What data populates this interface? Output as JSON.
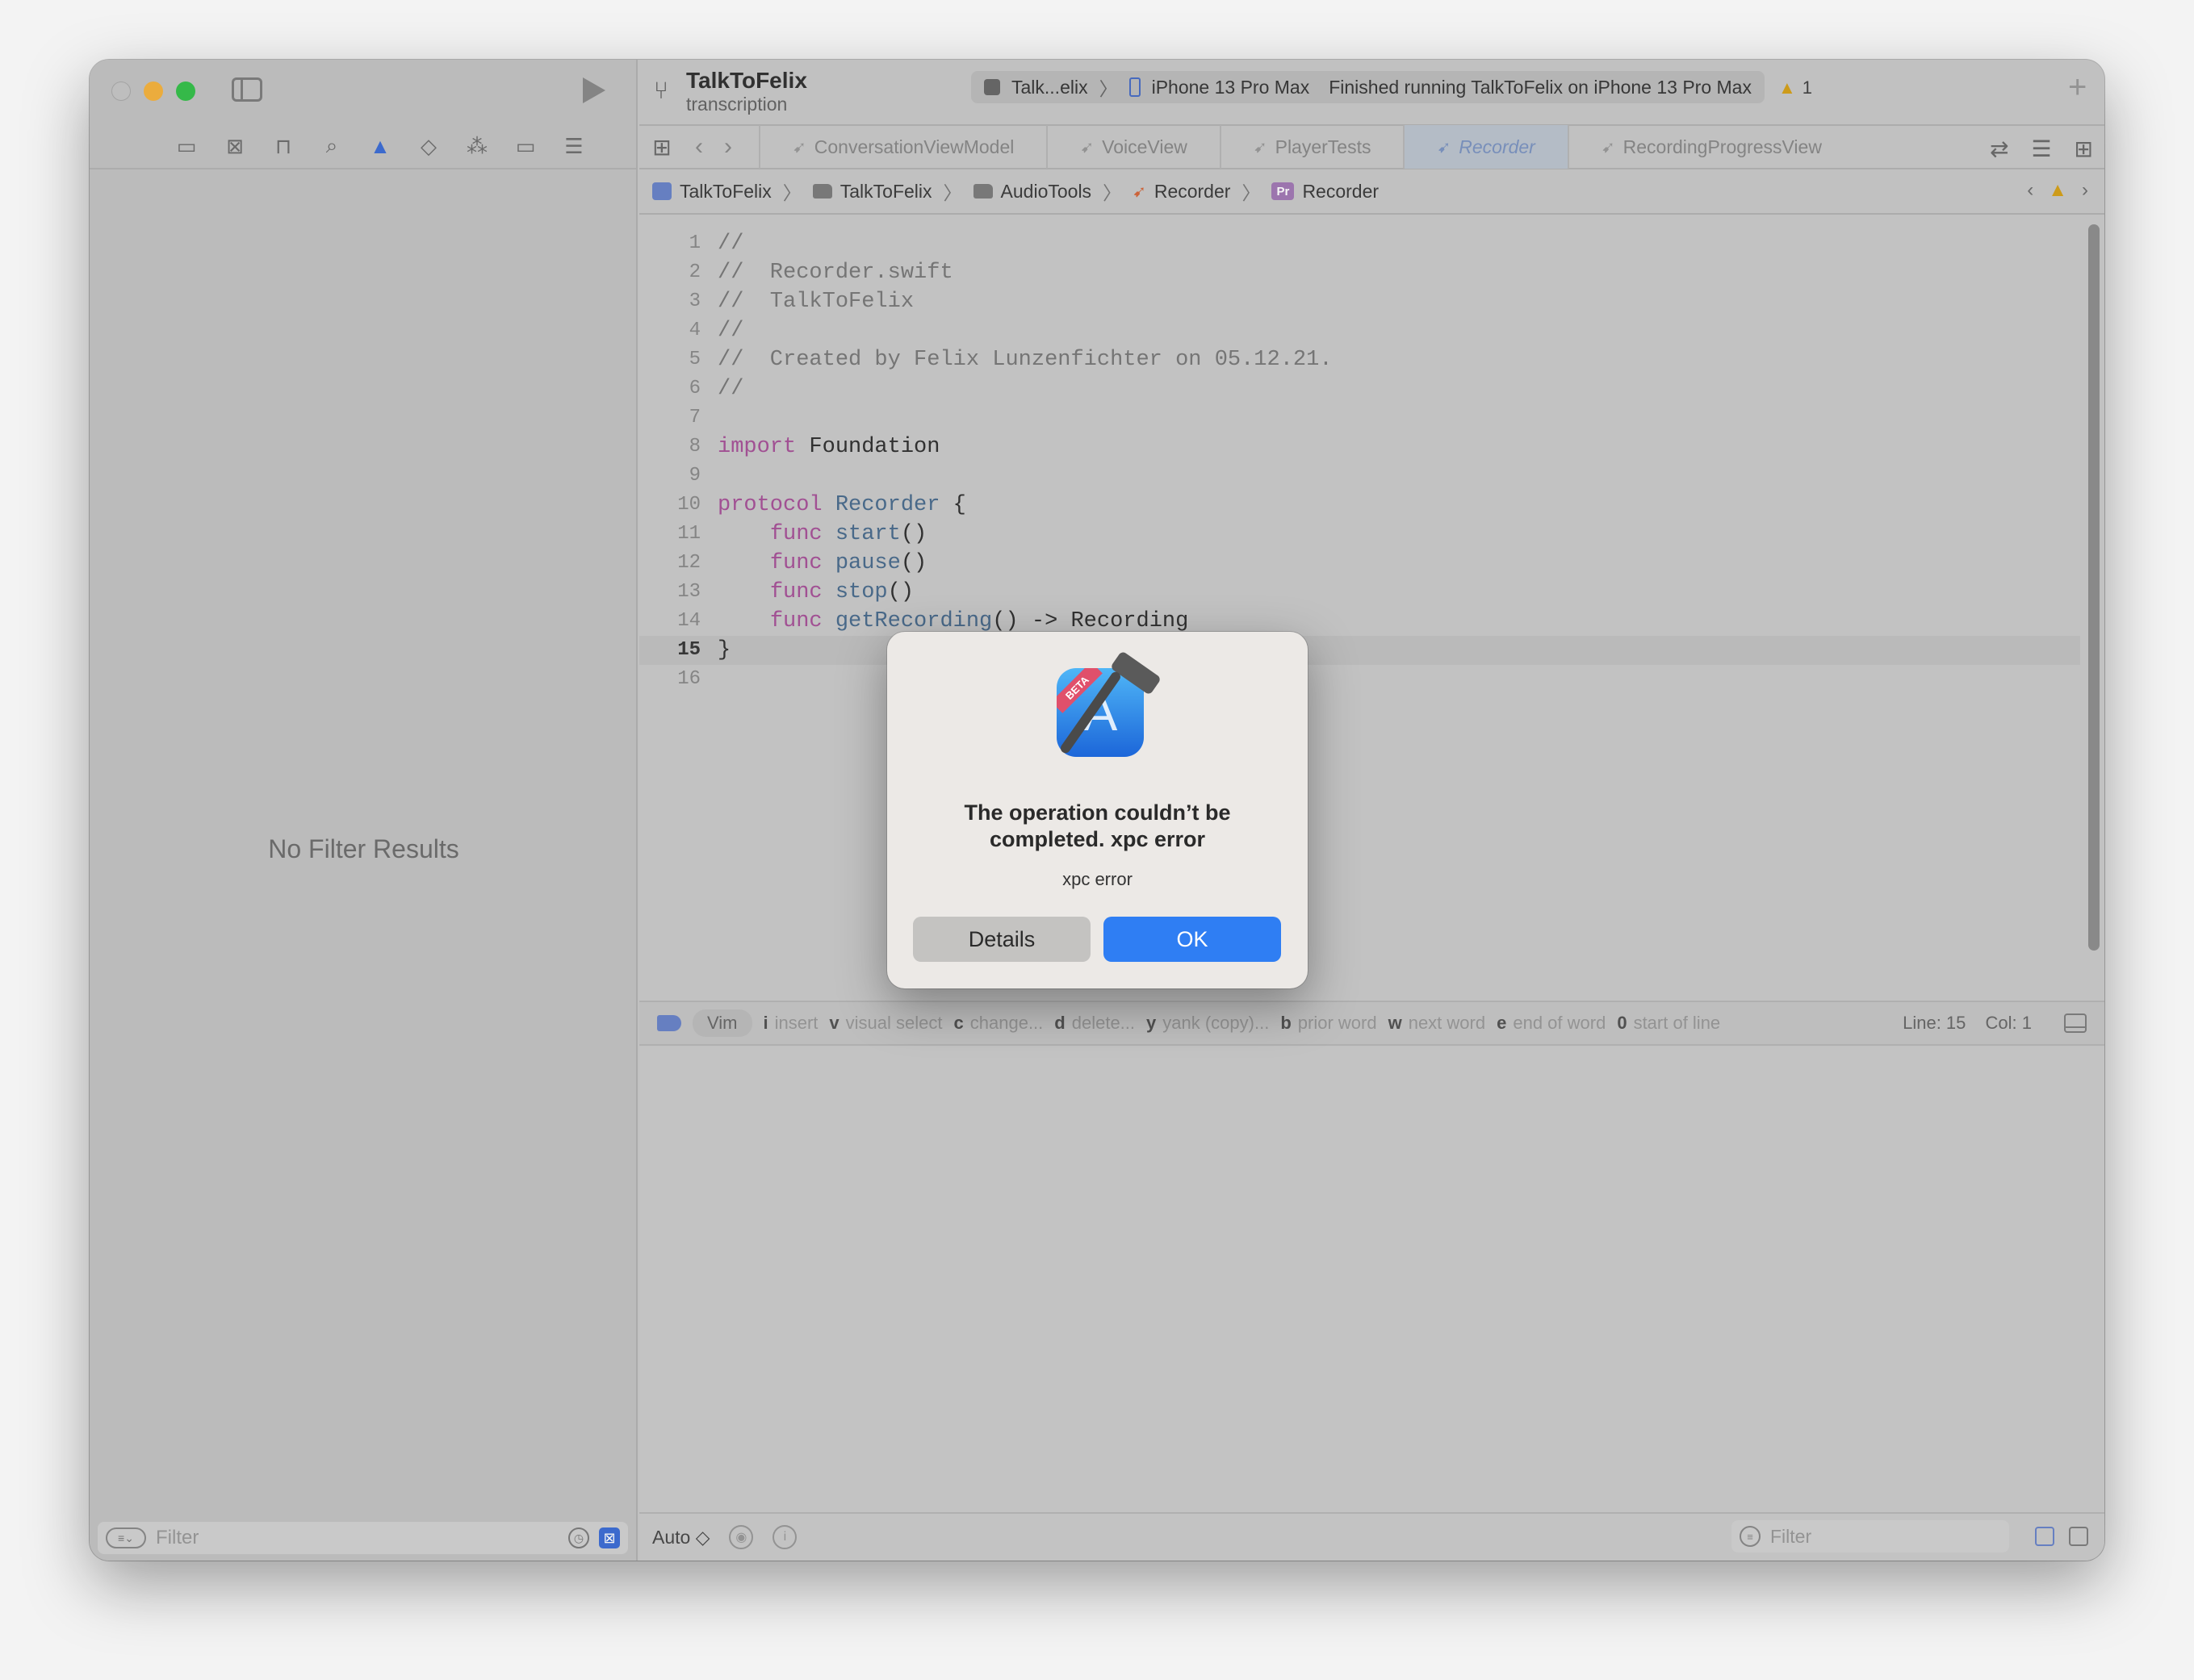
{
  "window": {
    "project_name": "TalkToFelix",
    "branch": "transcription",
    "activity": {
      "scheme": "Talk...elix",
      "device": "iPhone 13 Pro Max",
      "status": "Finished running TalkToFelix on iPhone 13 Pro Max"
    },
    "warning_count": "1"
  },
  "sidebar": {
    "empty_message": "No Filter Results",
    "filter_placeholder": "Filter"
  },
  "tabs": [
    {
      "label": "ConversationViewModel"
    },
    {
      "label": "VoiceView"
    },
    {
      "label": "PlayerTests"
    },
    {
      "label": "Recorder"
    },
    {
      "label": "RecordingProgressView"
    }
  ],
  "jumpbar": {
    "project": "TalkToFelix",
    "group": "TalkToFelix",
    "folder": "AudioTools",
    "file": "Recorder",
    "symbol_badge": "Pr",
    "symbol": "Recorder"
  },
  "code": {
    "current_line": 15,
    "lines": [
      {
        "n": "1",
        "text": "//"
      },
      {
        "n": "2",
        "text": "//  Recorder.swift"
      },
      {
        "n": "3",
        "text": "//  TalkToFelix"
      },
      {
        "n": "4",
        "text": "//"
      },
      {
        "n": "5",
        "text": "//  Created by Felix Lunzenfichter on 05.12.21."
      },
      {
        "n": "6",
        "text": "//"
      },
      {
        "n": "7",
        "text": ""
      },
      {
        "n": "8",
        "text": "import Foundation"
      },
      {
        "n": "9",
        "text": ""
      },
      {
        "n": "10",
        "text": "protocol Recorder {"
      },
      {
        "n": "11",
        "text": "    func start()"
      },
      {
        "n": "12",
        "text": "    func pause()"
      },
      {
        "n": "13",
        "text": "    func stop()"
      },
      {
        "n": "14",
        "text": "    func getRecording() -> Recording"
      },
      {
        "n": "15",
        "text": "}"
      },
      {
        "n": "16",
        "text": ""
      }
    ]
  },
  "vim": {
    "mode": "Vim",
    "hints": [
      {
        "key": "i",
        "label": "insert"
      },
      {
        "key": "v",
        "label": "visual select"
      },
      {
        "key": "c",
        "label": "change..."
      },
      {
        "key": "d",
        "label": "delete..."
      },
      {
        "key": "y",
        "label": "yank (copy)..."
      },
      {
        "key": "b",
        "label": "prior word"
      },
      {
        "key": "w",
        "label": "next word"
      },
      {
        "key": "e",
        "label": "end of word"
      },
      {
        "key": "0",
        "label": "start of line"
      }
    ],
    "line": "Line: 15",
    "col": "Col: 1"
  },
  "debug": {
    "auto_label": "Auto ◇",
    "filter_placeholder": "Filter"
  },
  "alert": {
    "badge": "BETA",
    "title": "The operation couldn’t be completed. xpc error",
    "message": "xpc error",
    "details_label": "Details",
    "ok_label": "OK"
  },
  "colors": {
    "accent": "#2f7ef3",
    "keyword": "#a8549a",
    "comment": "#7a7a7a",
    "type": "#4c6e8f"
  }
}
